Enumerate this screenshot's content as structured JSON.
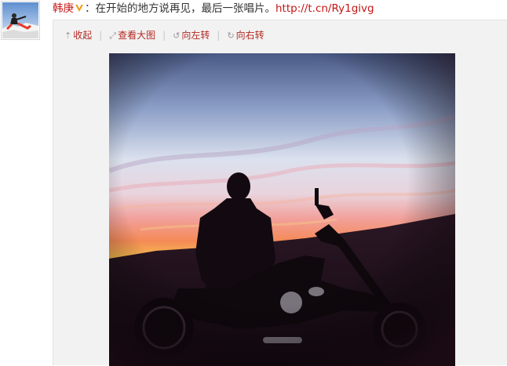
{
  "post": {
    "author": "韩庚",
    "badge_icon": "verified-v-icon",
    "colon": "：",
    "text": "在开始的地方说再见，最后一张唱片。",
    "link": "http://t.cn/Ry1givg"
  },
  "toolbar": {
    "collapse": "收起",
    "view_large": "查看大图",
    "rotate_left": "向左转",
    "rotate_right": "向右转",
    "separator": "|",
    "collapse_icon": "arrow-up-icon",
    "view_large_icon": "magnify-icon",
    "rotate_left_icon": "rotate-left-icon",
    "rotate_right_icon": "rotate-right-icon"
  },
  "colors": {
    "link_red": "#c51515",
    "tool_red": "#b42a22",
    "panel_bg": "#f2f2f2"
  }
}
